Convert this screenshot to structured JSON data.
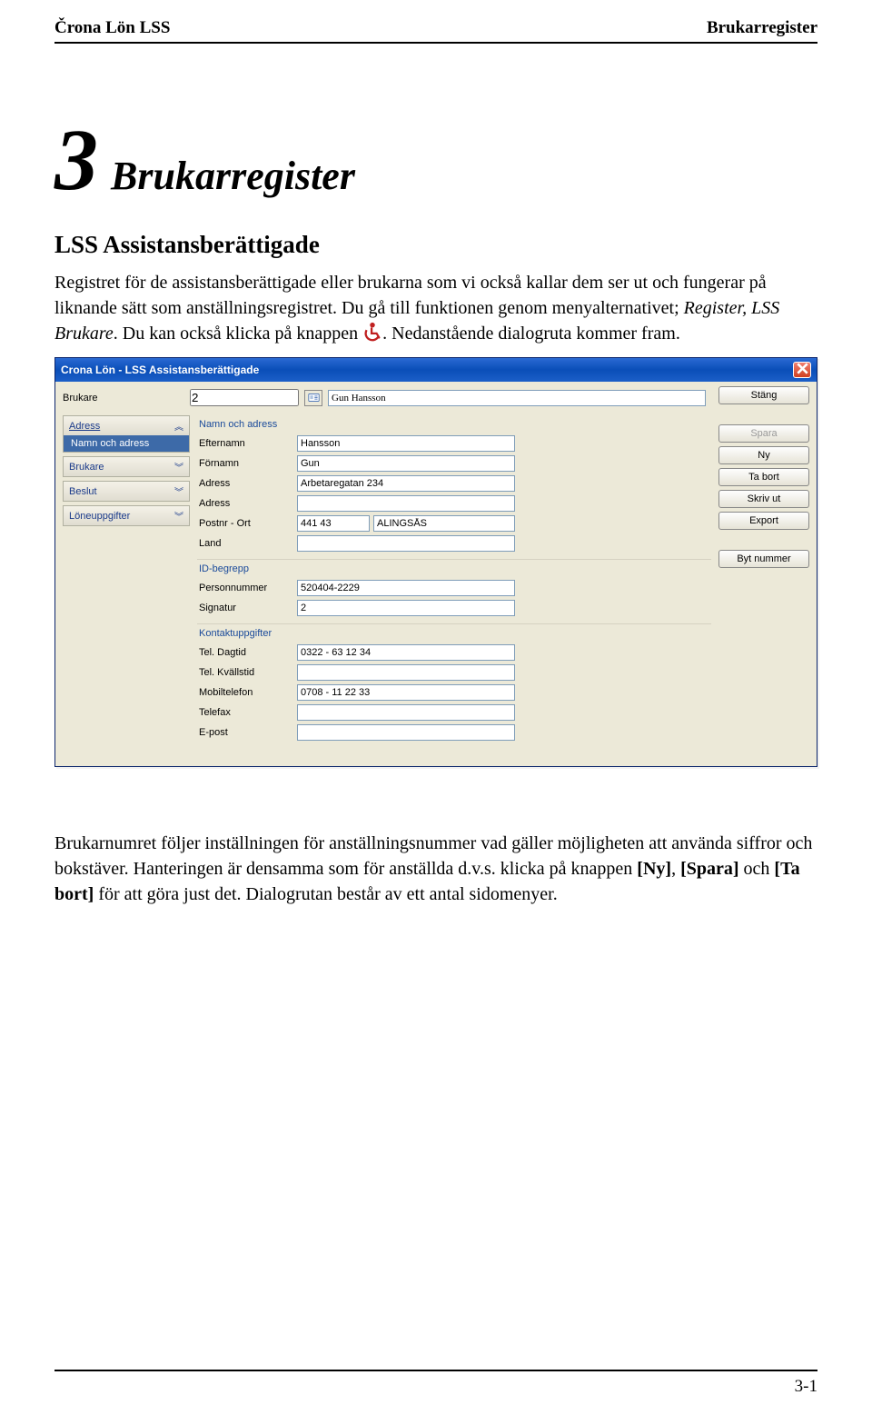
{
  "header": {
    "left": "Črona Lön LSS",
    "right": "Brukarregister"
  },
  "chapter": {
    "num": "3",
    "title": "Brukarregister"
  },
  "section_title": "LSS Assistansberättigade",
  "para1_a": "Registret för de assistansberättigade eller brukarna som vi också kallar dem ser ut och fungerar på liknande sätt som anställningsregistret. Du gå till funktionen genom menyalternativet; ",
  "para1_italic": "Register, LSS Brukare",
  "para1_b": ". Du kan också klicka på knappen ",
  "para1_c": ". Nedanstående dialogruta kommer fram.",
  "app": {
    "title": "Crona Lön - LSS Assistansberättigade",
    "top": {
      "label": "Brukare",
      "number": "2",
      "name": "Gun Hansson"
    },
    "nav": {
      "adress": "Adress",
      "adress_sub": "Namn och adress",
      "brukare": "Brukare",
      "beslut": "Beslut",
      "loneuppgifter": "Löneuppgifter"
    },
    "groups": {
      "namn": "Namn och adress",
      "id": "ID-begrepp",
      "kontakt": "Kontaktuppgifter"
    },
    "labels": {
      "efternamn": "Efternamn",
      "fornamn": "Förnamn",
      "adress": "Adress",
      "adress2": "Adress",
      "postnr_ort": "Postnr - Ort",
      "land": "Land",
      "personnummer": "Personnummer",
      "signatur": "Signatur",
      "tel_dagtid": "Tel. Dagtid",
      "tel_kvallstid": "Tel. Kvällstid",
      "mobiltelefon": "Mobiltelefon",
      "telefax": "Telefax",
      "epost": "E-post"
    },
    "values": {
      "efternamn": "Hansson",
      "fornamn": "Gun",
      "adress": "Arbetaregatan 234",
      "adress2": "",
      "postnr": "441 43",
      "ort": "ALINGSÅS",
      "land": "",
      "personnummer": "520404-2229",
      "signatur": "2",
      "tel_dagtid": "0322 - 63 12 34",
      "tel_kvallstid": "",
      "mobiltelefon": "0708 - 11 22 33",
      "telefax": "",
      "epost": ""
    },
    "buttons": {
      "stang": "Stäng",
      "spara": "Spara",
      "ny": "Ny",
      "tabort": "Ta bort",
      "skrivut": "Skriv ut",
      "export": "Export",
      "bytnummer": "Byt nummer"
    }
  },
  "para2_a": "Brukarnumret följer inställningen för anställningsnummer vad gäller möjligheten att använda siffror och bokstäver. Hanteringen är densamma som för anställda d.v.s. klicka på knappen ",
  "para2_b1": "[Ny]",
  "para2_c1": ", ",
  "para2_b2": "[Spara]",
  "para2_c2": " och ",
  "para2_b3": "[Ta bort]",
  "para2_d": " för att göra just det. Dialogrutan består av ett antal sidomenyer.",
  "footer": "3-1"
}
